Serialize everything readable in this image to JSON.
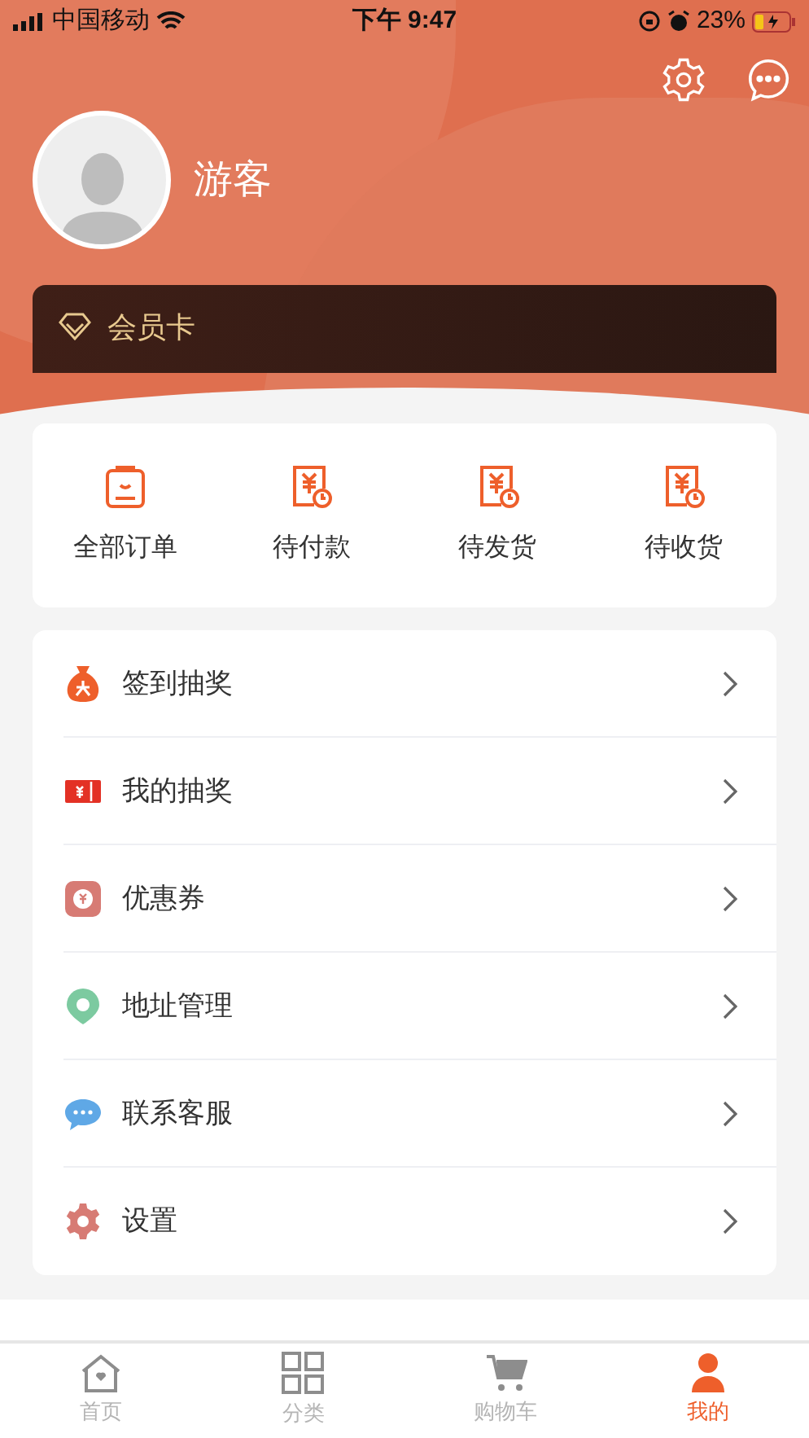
{
  "status_bar": {
    "carrier": "中国移动",
    "time": "下午 9:47",
    "battery": "23%"
  },
  "profile": {
    "name": "游客"
  },
  "member_card": {
    "label": "会员卡"
  },
  "orders": [
    {
      "label": "全部订单",
      "kind": "all"
    },
    {
      "label": "待付款",
      "kind": "bill"
    },
    {
      "label": "待发货",
      "kind": "bill"
    },
    {
      "label": "待收货",
      "kind": "bill"
    }
  ],
  "menu": [
    {
      "label": "签到抽奖",
      "kind": "bag"
    },
    {
      "label": "我的抽奖",
      "kind": "ticket"
    },
    {
      "label": "优惠券",
      "kind": "coupon"
    },
    {
      "label": "地址管理",
      "kind": "pin"
    },
    {
      "label": "联系客服",
      "kind": "chat"
    },
    {
      "label": "设置",
      "kind": "gear"
    }
  ],
  "tabbar": [
    {
      "label": "首页",
      "kind": "home",
      "selected": false
    },
    {
      "label": "分类",
      "kind": "grid",
      "selected": false
    },
    {
      "label": "购物车",
      "kind": "cart",
      "selected": false
    },
    {
      "label": "我的",
      "kind": "user",
      "selected": true
    }
  ]
}
